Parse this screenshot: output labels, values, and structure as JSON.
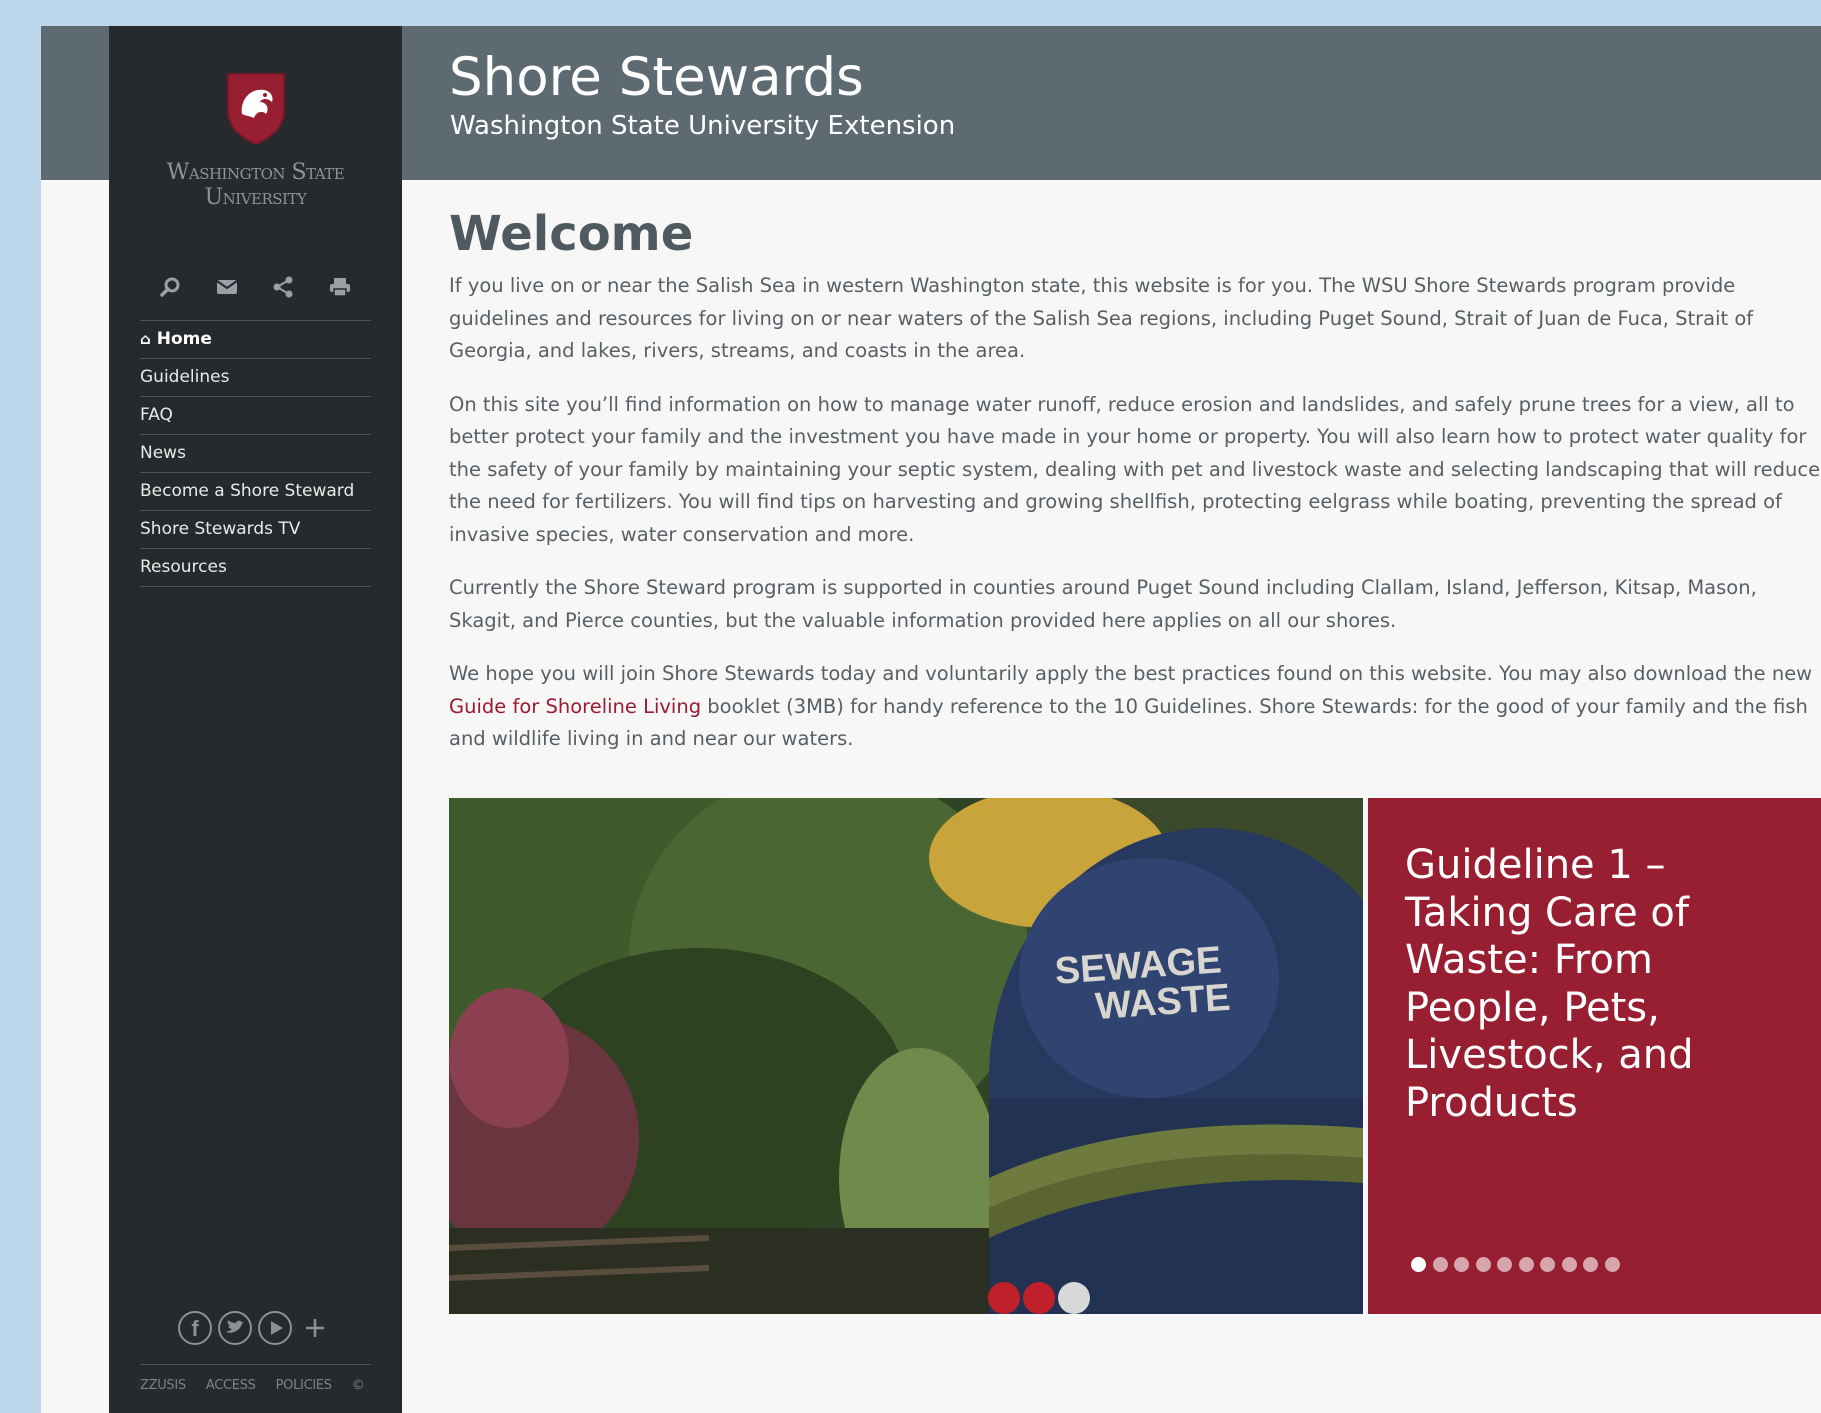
{
  "site": {
    "title": "Shore Stewards",
    "subtitle": "Washington State University Extension"
  },
  "sidebar": {
    "logo_text_line1": "Washington State",
    "logo_text_line2": "University",
    "tools": [
      "search-icon",
      "mail-icon",
      "share-icon",
      "print-icon"
    ],
    "nav": [
      {
        "label": "Home",
        "active": true
      },
      {
        "label": "Guidelines"
      },
      {
        "label": "FAQ"
      },
      {
        "label": "News"
      },
      {
        "label": "Become a Shore Steward"
      },
      {
        "label": "Shore Stewards TV"
      },
      {
        "label": "Resources"
      }
    ],
    "social": [
      "facebook-icon",
      "twitter-icon",
      "youtube-icon",
      "plus-icon"
    ],
    "footer": [
      "ZZUSIS",
      "ACCESS",
      "POLICIES",
      "©"
    ]
  },
  "main": {
    "heading": "Welcome",
    "p1": "If you live on or near the Salish Sea in western Washington state, this website is for you. The WSU Shore Stewards program provide guidelines and resources for living on or near waters of the Salish Sea regions, including Puget Sound, Strait of Juan de Fuca, Strait of Georgia, and lakes, rivers, streams, and coasts in the area.",
    "p2": "On this site you’ll find information on how to manage water runoff, reduce erosion and landslides, and safely prune trees for a view, all to better protect your family and the investment you have made in your home or property. You will also learn how to protect water quality for the safety of your family by maintaining your septic system, dealing with pet and livestock waste and selecting landscaping that will reduce the need for fertilizers. You will find tips on harvesting and growing shellfish, protecting eelgrass while boating, preventing the spread of invasive species, water conservation and more.",
    "p3": "Currently the Shore Steward program is supported in counties around Puget Sound including Clallam, Island, Jefferson, Kitsap, Mason, Skagit, and Pierce counties, but the valuable information provided here applies on all our shores.",
    "p4_before": "We hope you will join Shore Stewards today and voluntarily apply the best practices found on this website. You may also download the new ",
    "p4_link": "Guide for Shoreline Living",
    "p4_after": " booklet (3MB) for handy reference to the 10 Guidelines.  Shore Stewards: for the good of your family and the fish and wildlife living in and near our waters."
  },
  "slider": {
    "truck_text_line1": "SEWAGE",
    "truck_text_line2": "WASTE",
    "slide_title": "Guideline 1 – Taking Care of Waste: From People, Pets, Livestock, and Products",
    "dot_count": 10,
    "active_dot": 0
  },
  "colors": {
    "header": "#5e6a71",
    "sidebar": "#262a2d",
    "crimson": "#981e32",
    "body_text": "#585f64"
  }
}
